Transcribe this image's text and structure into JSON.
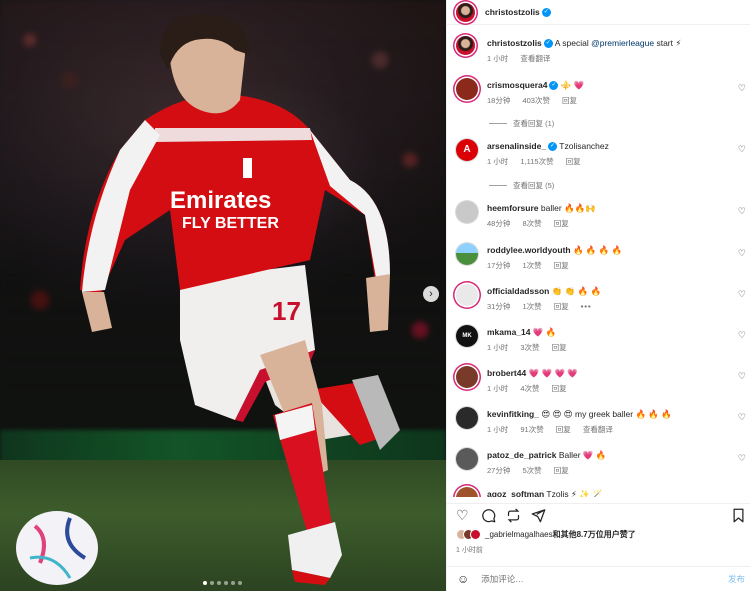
{
  "post": {
    "author": "christostzolis",
    "liked_by_prefix": "_gabrielmagalhaes",
    "liked_by_suffix": "和其他8.7万位用户赞了",
    "time": "1 小时前",
    "carousel": {
      "slides": 6,
      "active": 1
    }
  },
  "caption": {
    "username": "christostzolis",
    "text": "A special",
    "mention": "@premierleague",
    "text_after": "start ⚡",
    "time": "1 小时",
    "translate": "查看翻译"
  },
  "comments": [
    {
      "username": "crismosquera4",
      "text": "⚜️ 💗",
      "time": "18分钟",
      "likes": "403次赞",
      "reply": "回复",
      "view_replies": "查看回复 (1)",
      "verified": true,
      "avatar_color": "#8b2a1a"
    },
    {
      "username": "arsenalinside_",
      "text": "Tzolisanchez",
      "time": "1 小时",
      "likes": "1,115次赞",
      "reply": "回复",
      "view_replies": "查看回复 (5)",
      "verified": true,
      "avatar_color": "#db0007"
    },
    {
      "username": "heemforsure",
      "text": "baller 🔥🔥🙌",
      "time": "48分钟",
      "likes": "8次赞",
      "reply": "回复",
      "avatar_color": "#c9c9c9"
    },
    {
      "username": "roddylee.worldyouth",
      "text": "🔥 🔥 🔥 🔥",
      "time": "17分钟",
      "likes": "1次赞",
      "reply": "回复",
      "avatar_color": "#4a8f3c"
    },
    {
      "username": "officialdadsson",
      "text": "👏 👏 🔥 🔥",
      "time": "31分钟",
      "likes": "1次赞",
      "reply": "回复",
      "more": "•••",
      "avatar_color": "#e9e9e9"
    },
    {
      "username": "mkama_14",
      "text": "💗 🔥",
      "time": "1 小时",
      "likes": "3次赞",
      "reply": "回复",
      "avatar_color": "#111111"
    },
    {
      "username": "brobert44",
      "text": "💗 💗 💗 💗",
      "time": "1 小时",
      "likes": "4次赞",
      "reply": "回复",
      "avatar_color": "#7a3a2a"
    },
    {
      "username": "kevinfitking_",
      "text": "😍 😍 😍 my greek baller 🔥 🔥 🔥",
      "time": "1 小时",
      "likes": "91次赞",
      "reply": "回复",
      "translate": "查看翻译",
      "avatar_color": "#2a2a2a"
    },
    {
      "username": "patoz_de_patrick",
      "text": "Baller 💗 🔥",
      "time": "27分钟",
      "likes": "5次赞",
      "reply": "回复",
      "avatar_color": "#5a5a5a"
    },
    {
      "username": "agoz_softman",
      "text": "Tzolis ⚡ ✨ 🪄",
      "avatar_color": "#a0522d"
    }
  ],
  "icons": {
    "like": "heart-icon",
    "comment": "comment-icon",
    "share": "repost-icon",
    "send": "send-icon",
    "save": "bookmark-icon",
    "emoji": "emoji-icon",
    "next": "chevron-right-icon"
  },
  "add_comment": {
    "placeholder": "添加评论…",
    "post_label": "发布"
  },
  "colors": {
    "accent": "#0095f6",
    "verified": "#0095f6",
    "arsenal_red": "#db0007"
  }
}
